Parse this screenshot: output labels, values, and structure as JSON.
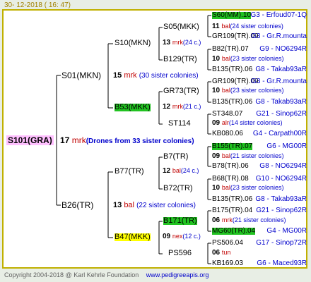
{
  "header": {
    "date": "30- 12-2018 ( 16: 47)"
  },
  "footer": {
    "copyright": "Copyright 2004-2018 @ Karl Kehrle Foundation",
    "site": "www.pedigreeapis.org"
  },
  "root": {
    "label": "S101(GRA)",
    "num": "17",
    "mark": "mrk",
    "note": "(Drones from 33 sister colonies)"
  },
  "gen1": [
    {
      "label": "S01(MKN)",
      "num": "15",
      "mark": "mrk",
      "note": "(30 sister colonies)"
    },
    {
      "label": "B26(TR)",
      "num": "13",
      "mark": "bal",
      "note": "(22 sister colonies)"
    }
  ],
  "gen2": [
    {
      "label": "S10(MKN)",
      "num": "13",
      "mark": "mrk",
      "note": "(24 c.)"
    },
    {
      "label": "B53(MKK)",
      "num": "12",
      "mark": "mrk",
      "note": "(21 c.)"
    },
    {
      "label": "B77(TR)",
      "num": "12",
      "mark": "bal",
      "note": "(24 c.)"
    },
    {
      "label": "B47(MKK)",
      "num": "09",
      "mark": "nex",
      "note": "(12 c.)"
    }
  ],
  "gen3": [
    {
      "label": "S05(MKK)",
      "num": "11",
      "mark": "bal",
      "note": "(24 sister colonies)"
    },
    {
      "label": "B129(TR)",
      "num": "10",
      "mark": "bal",
      "note": "(23 sister colonies)"
    },
    {
      "label": "GR73(TR)",
      "num": "10",
      "mark": "bal",
      "note": "(23 sister colonies)"
    },
    {
      "label": "ST114",
      "num": "09",
      "mark": "alr",
      "note": "(14 sister colonies)"
    },
    {
      "label": "B7(TR)",
      "num": "09",
      "mark": "bal",
      "note": "(21 sister colonies)"
    },
    {
      "label": "B72(TR)",
      "num": "10",
      "mark": "bal",
      "note": "(23 sister colonies)"
    },
    {
      "label": "B171(TR)",
      "num": "06",
      "mark": "mrk",
      "note": "(21 sister colonies)"
    },
    {
      "label": "PS596",
      "num": "06",
      "mark": "tun",
      "note": ""
    }
  ],
  "gen4": [
    {
      "label": "S60(MM).10",
      "info": "G3 - Erfoud07-1Q"
    },
    {
      "label": "GR109(TR).09",
      "info": "G3 - Gr.R.mounta"
    },
    {
      "label": "B82(TR).07",
      "info": "G9 - NO6294R"
    },
    {
      "label": "B135(TR).06",
      "info": "G8 - Takab93aR"
    },
    {
      "label": "GR109(TR).09",
      "info": "G3 - Gr.R.mounta"
    },
    {
      "label": "B135(TR).06",
      "info": "G8 - Takab93aR"
    },
    {
      "label": "ST348.07",
      "info": "G21 - Sinop62R"
    },
    {
      "label": "KB080.06",
      "info": "G4 - Carpath00R"
    },
    {
      "label": "B155(TR).07",
      "info": "G6 - MG00R"
    },
    {
      "label": "B78(TR).06",
      "info": "G8 - NO6294R"
    },
    {
      "label": "B68(TR).08",
      "info": "G10 - NO6294R"
    },
    {
      "label": "B135(TR).06",
      "info": "G8 - Takab93aR"
    },
    {
      "label": "B175(TR).04",
      "info": "G21 - Sinop62R"
    },
    {
      "label": "MG60(TR).04",
      "info": "G4 - MG00R"
    },
    {
      "label": "PS506.04",
      "info": "G17 - Sinop72R"
    },
    {
      "label": "KB169.03",
      "info": "G6 - Maced93R"
    }
  ],
  "colors": {
    "frame": "#c0b000",
    "lines": "#000000",
    "highlight_green": "#21c321",
    "highlight_yellow": "#ffff00",
    "root_bg": "#ffc0ff",
    "mark_red": "#c00000",
    "info_blue": "#0000cc"
  }
}
